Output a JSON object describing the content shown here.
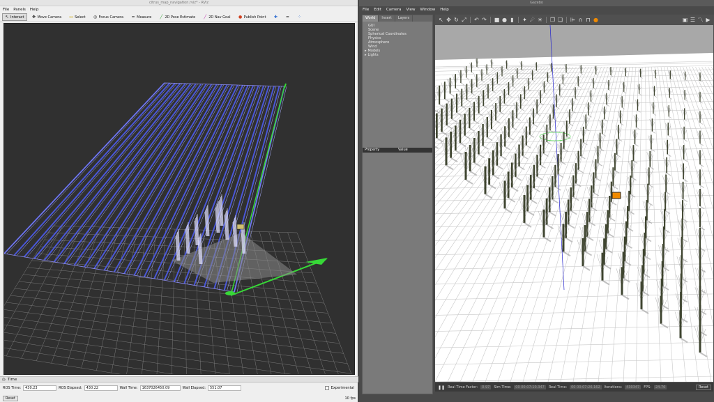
{
  "rviz": {
    "title": "citrus_map_navigation.rviz* - RViz",
    "menu": [
      "File",
      "Panels",
      "Help"
    ],
    "tools": [
      {
        "label": "Interact",
        "icon": "interact-icon",
        "glyph": "↖",
        "active": true
      },
      {
        "label": "Move Camera",
        "icon": "move-camera-icon",
        "glyph": "✥"
      },
      {
        "label": "Select",
        "icon": "select-icon",
        "glyph": "▭"
      },
      {
        "label": "Focus Camera",
        "icon": "focus-camera-icon",
        "glyph": "◎"
      },
      {
        "label": "Measure",
        "icon": "measure-icon",
        "glyph": "━"
      },
      {
        "label": "2D Pose Estimate",
        "icon": "pose-estimate-icon",
        "glyph": "╱"
      },
      {
        "label": "2D Nav Goal",
        "icon": "nav-goal-icon",
        "glyph": "╱"
      },
      {
        "label": "Publish Point",
        "icon": "publish-point-icon",
        "glyph": "●"
      }
    ],
    "tool_colors": {
      "pose": "#3aa63a",
      "goal": "#c03ab0",
      "point": "#d04020"
    },
    "time_panel": {
      "title": "Time",
      "ros_time_label": "ROS Time:",
      "ros_time": "430.23",
      "ros_elapsed_label": "ROS Elapsed:",
      "ros_elapsed": "430.22",
      "wall_time_label": "Wall Time:",
      "wall_time": "1637026450.09",
      "wall_elapsed_label": "Wall Elapsed:",
      "wall_elapsed": "551.07",
      "experimental": "Experimental"
    },
    "reset": "Reset",
    "fps": "10 fps"
  },
  "gazebo": {
    "title": "Gazebo",
    "menu": [
      "File",
      "Edit",
      "Camera",
      "View",
      "Window",
      "Help"
    ],
    "tabs": [
      "World",
      "Insert",
      "Layers"
    ],
    "tree": [
      "GUI",
      "Scene",
      "Spherical Coordinates",
      "Physics",
      "Atmosphere",
      "Wind",
      "Models",
      "Lights"
    ],
    "prop_header": {
      "property": "Property",
      "value": "Value"
    },
    "status": {
      "rtf_label": "Real Time Factor:",
      "rtf": "0.97",
      "sim_label": "Sim Time:",
      "sim": "00 00:07:10.347",
      "real_label": "Real Time:",
      "real": "00 00:07:26.162",
      "iter_label": "Iterations:",
      "iter": "430347",
      "fps_label": "FPS:",
      "fps": "24.76",
      "reset": "Reset"
    }
  }
}
